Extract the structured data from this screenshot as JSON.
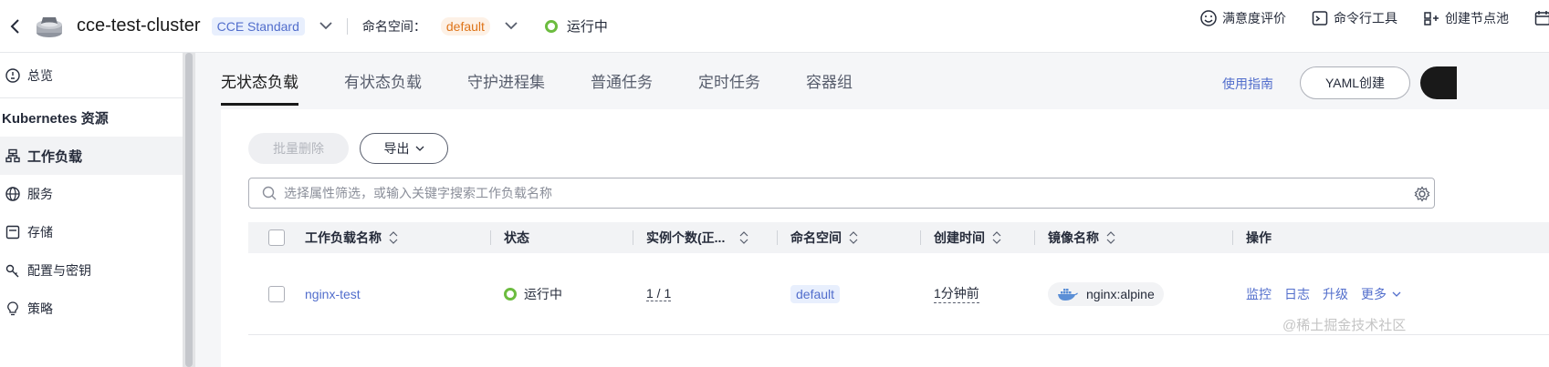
{
  "cluster": {
    "name": "cce-test-cluster",
    "edition": "CCE Standard",
    "namespace_label": "命名空间：",
    "namespace": "default",
    "status": "运行中"
  },
  "top_actions": [
    "满意度评价",
    "命令行工具",
    "创建节点池"
  ],
  "sidebar": {
    "overview": "总览",
    "group": "Kubernetes 资源",
    "items": [
      "工作负载",
      "服务",
      "存储",
      "配置与密钥",
      "策略"
    ]
  },
  "tabs": [
    "无状态负载",
    "有状态负载",
    "守护进程集",
    "普通任务",
    "定时任务",
    "容器组"
  ],
  "guide_link": "使用指南",
  "yaml_button": "YAML创建",
  "toolbar": {
    "batch_delete": "批量删除",
    "export": "导出"
  },
  "search": {
    "placeholder": "选择属性筛选，或输入关键字搜索工作负载名称"
  },
  "table": {
    "headers": [
      "工作负载名称",
      "状态",
      "实例个数(正...",
      "命名空间",
      "创建时间",
      "镜像名称",
      "操作"
    ],
    "rows": [
      {
        "name": "nginx-test",
        "status": "运行中",
        "instances": "1 / 1",
        "namespace": "default",
        "created": "1分钟前",
        "image": "nginx:alpine",
        "ops": [
          "监控",
          "日志",
          "升级",
          "更多"
        ]
      }
    ]
  },
  "watermark": "@稀土掘金技术社区",
  "colors": {
    "accent": "#526ecc",
    "running": "#6cbc3f",
    "namespace_badge": "#de7419"
  }
}
